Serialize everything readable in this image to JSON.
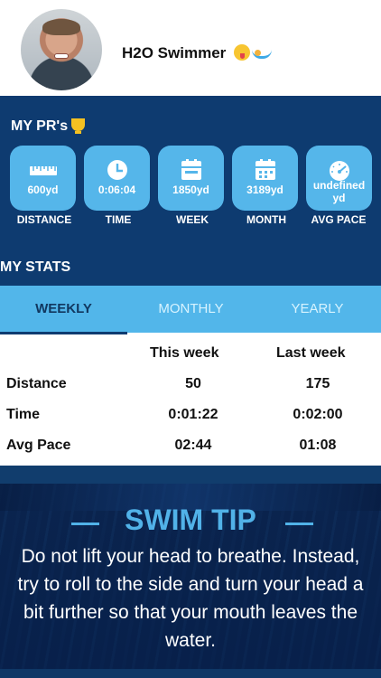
{
  "profile": {
    "name": "H2O Swimmer"
  },
  "pr_section": {
    "title": "MY PR's",
    "cards": [
      {
        "value": "600yd",
        "label": "DISTANCE",
        "icon": "ruler-icon"
      },
      {
        "value": "0:06:04",
        "label": "TIME",
        "icon": "clock-icon"
      },
      {
        "value": "1850yd",
        "label": "WEEK",
        "icon": "calendar-icon"
      },
      {
        "value": "3189yd",
        "label": "MONTH",
        "icon": "calendar-grid-icon"
      },
      {
        "value": "undefined\nyd",
        "label": "AVG PACE",
        "icon": "speedometer-icon"
      }
    ]
  },
  "stats": {
    "title": "MY STATS",
    "tabs": [
      "WEEKLY",
      "MONTHLY",
      "YEARLY"
    ],
    "active_tab": "WEEKLY",
    "columns": [
      "This week",
      "Last week"
    ],
    "rows": [
      {
        "label": "Distance",
        "this_week": "50",
        "last_week": "175"
      },
      {
        "label": "Time",
        "this_week": "0:01:22",
        "last_week": "0:02:00"
      },
      {
        "label": "Avg Pace",
        "this_week": "02:44",
        "last_week": "01:08"
      }
    ]
  },
  "tip": {
    "title": "SWIM TIP",
    "text": "Do not lift your head to breathe. Instead, try to roll to the side and turn your head a bit further so that your mouth leaves the water."
  },
  "colors": {
    "navy": "#0e3b70",
    "blue": "#55b6ea",
    "tip_title": "#51b2e8"
  }
}
